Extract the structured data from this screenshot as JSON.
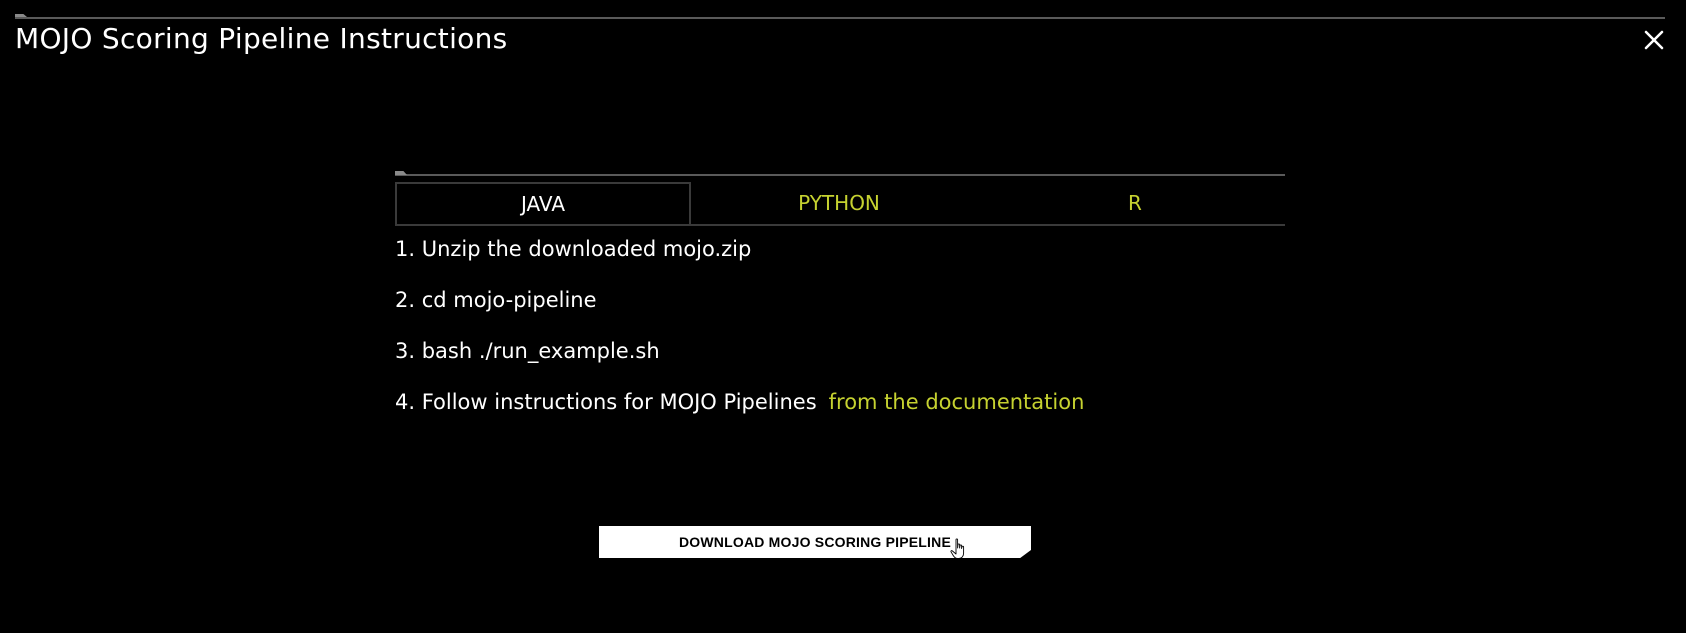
{
  "dialog": {
    "title": "MOJO Scoring Pipeline Instructions",
    "close_icon": "close-icon"
  },
  "tabs": [
    {
      "label": "JAVA",
      "active": true
    },
    {
      "label": "PYTHON",
      "active": false
    },
    {
      "label": "R",
      "active": false
    }
  ],
  "steps": [
    {
      "text": "1. Unzip the downloaded mojo.zip"
    },
    {
      "text": "2. cd mojo-pipeline"
    },
    {
      "text": "3. bash ./run_example.sh"
    },
    {
      "text": "4. Follow instructions for MOJO Pipelines",
      "link_text": "from the documentation"
    }
  ],
  "download_button": {
    "label": "DOWNLOAD MOJO SCORING PIPELINE"
  },
  "colors": {
    "background": "#000000",
    "accent": "#c6d230",
    "text": "#ffffff",
    "rule": "#5a5a5a"
  }
}
